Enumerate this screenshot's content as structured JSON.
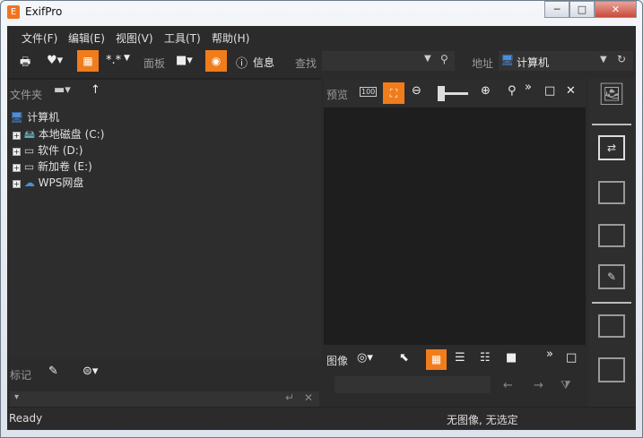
{
  "window": {
    "title": "ExifPro",
    "app_icon": "E",
    "min": "─",
    "max": "□",
    "close": "✕"
  },
  "menu": [
    "文件(F)",
    "编辑(E)",
    "视图(V)",
    "工具(T)",
    "帮助(H)"
  ],
  "toolbar": {
    "panel_label": "面板",
    "info_label": "信息",
    "search_label": "查找",
    "search_value": "",
    "address_label": "地址",
    "address_value": "计算机",
    "stars": "*.*"
  },
  "folders": {
    "header": "文件夹",
    "root": "计算机",
    "items": [
      "本地磁盘 (C:)",
      "软件 (D:)",
      "新加卷 (E:)",
      "WPS网盘"
    ]
  },
  "preview": {
    "header": "预览",
    "zoom100": "100"
  },
  "tags": {
    "header": "标记"
  },
  "images": {
    "header": "图像"
  },
  "status": {
    "left": "Ready",
    "right": "无图像, 无选定"
  },
  "colors": {
    "accent": "#f07c1a",
    "background": "#2b2b2b"
  }
}
